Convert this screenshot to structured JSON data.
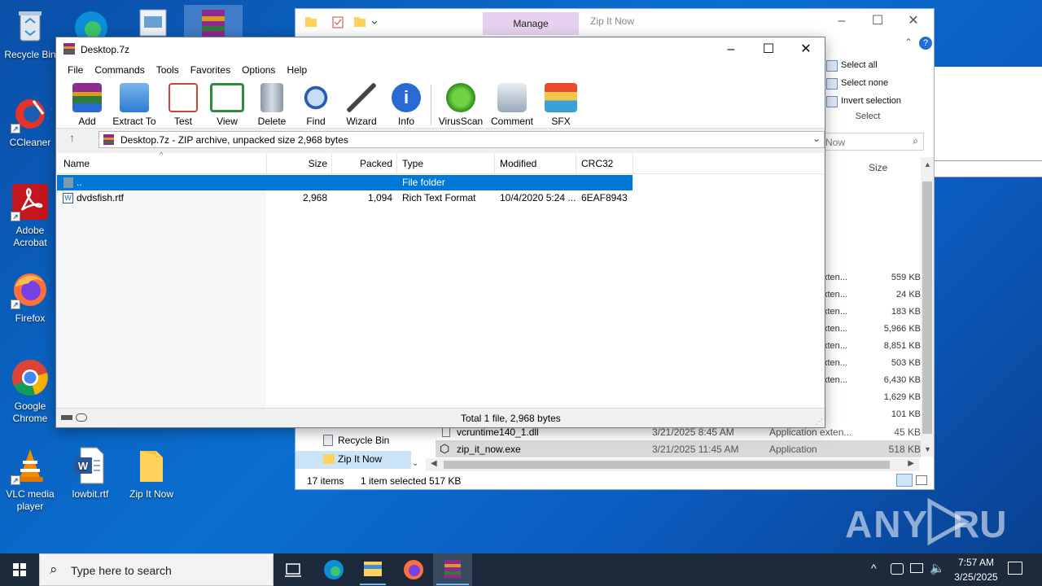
{
  "desktop": {
    "icons": [
      {
        "label": "Recycle Bin"
      },
      {
        "label": "CCleaner"
      },
      {
        "label": "Adobe Acrobat"
      },
      {
        "label": "Firefox"
      },
      {
        "label": "Google Chrome"
      },
      {
        "label": "VLC media player"
      },
      {
        "label": "lowbit.rtf"
      },
      {
        "label": "Zip It Now"
      }
    ]
  },
  "explorer": {
    "manage_tab": "Manage",
    "title": "Zip It Now",
    "select_all": "Select all",
    "select_none": "Select none",
    "invert_selection": "Invert selection",
    "select_group": "Select",
    "search_placeholder": "Now",
    "size_header": "Size",
    "type_fragment": "xten...",
    "sizes": [
      "559 KB",
      "24 KB",
      "183 KB",
      "5,966 KB",
      "8,851 KB",
      "503 KB",
      "6,430 KB",
      "1,629 KB",
      "101 KB"
    ],
    "nav_recycle_bin": "Recycle Bin",
    "nav_zip_it_now": "Zip It Now",
    "file_rows": [
      {
        "name": "vcruntime140_1.dll",
        "modified": "3/21/2025 8:45 AM",
        "type": "Application exten...",
        "size": "45 KB"
      },
      {
        "name": "zip_it_now.exe",
        "modified": "3/21/2025 11:45 AM",
        "type": "Application",
        "size": "518 KB"
      }
    ],
    "status_items": "17 items",
    "status_selected": "1 item selected",
    "status_size": "517 KB"
  },
  "winrar": {
    "title": "Desktop.7z",
    "menu": [
      "File",
      "Commands",
      "Tools",
      "Favorites",
      "Options",
      "Help"
    ],
    "toolbar": [
      "Add",
      "Extract To",
      "Test",
      "View",
      "Delete",
      "Find",
      "Wizard",
      "Info",
      "VirusScan",
      "Comment",
      "SFX"
    ],
    "address": "Desktop.7z - ZIP archive, unpacked size 2,968 bytes",
    "columns": [
      "Name",
      "Size",
      "Packed",
      "Type",
      "Modified",
      "CRC32"
    ],
    "rows": [
      {
        "name": "..",
        "size": "",
        "packed": "",
        "type": "File folder",
        "modified": "",
        "crc": ""
      },
      {
        "name": "dvdsfish.rtf",
        "size": "2,968",
        "packed": "1,094",
        "type": "Rich Text Format",
        "modified": "10/4/2020 5:24 ...",
        "crc": "6EAF8943"
      }
    ],
    "status": "Total 1 file, 2,968 bytes"
  },
  "taskbar": {
    "search_placeholder": "Type here to search",
    "time": "7:57 AM",
    "date": "3/25/2025"
  },
  "watermark": "ANY RUN"
}
